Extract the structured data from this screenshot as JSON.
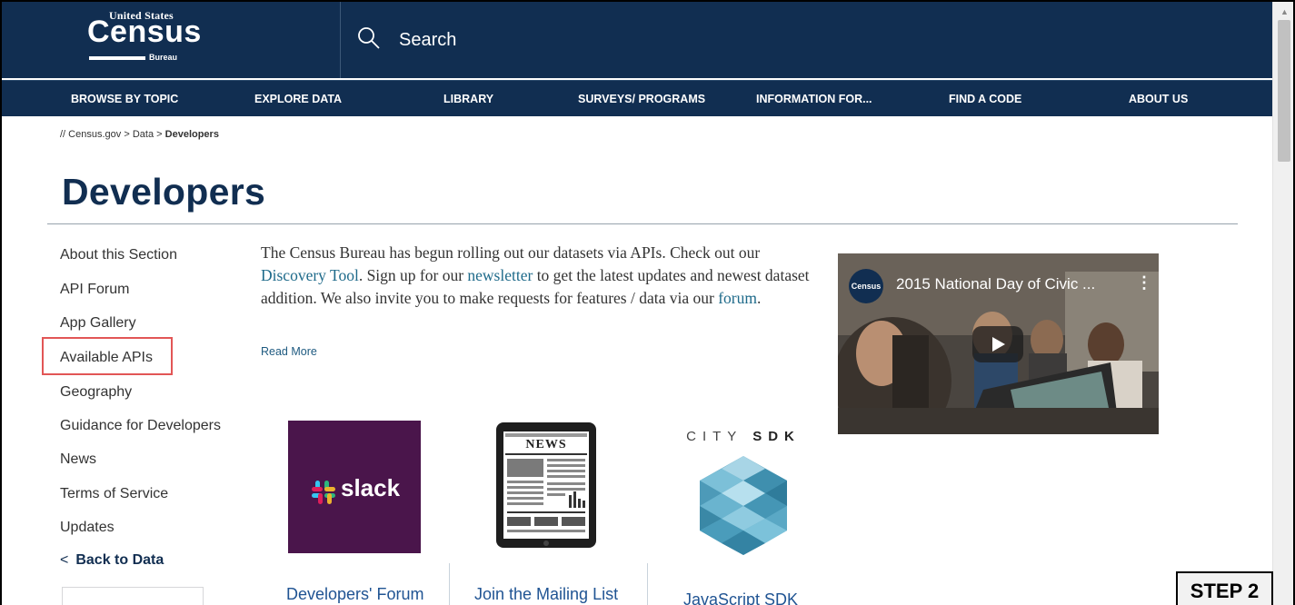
{
  "header": {
    "logo": {
      "line1": "United States",
      "line2": "Census",
      "line3": "Bureau"
    },
    "search_label": "Search"
  },
  "nav": {
    "items": [
      {
        "label": "BROWSE BY TOPIC"
      },
      {
        "label": "EXPLORE DATA"
      },
      {
        "label": "LIBRARY"
      },
      {
        "label": "SURVEYS/ PROGRAMS"
      },
      {
        "label": "INFORMATION FOR..."
      },
      {
        "label": "FIND A CODE"
      },
      {
        "label": "ABOUT US"
      }
    ]
  },
  "breadcrumb": {
    "root": "Census.gov",
    "sep": ">",
    "parent": "Data",
    "current": "Developers"
  },
  "page": {
    "title": "Developers"
  },
  "sidebar": {
    "items": [
      {
        "label": "About this Section"
      },
      {
        "label": "API Forum"
      },
      {
        "label": "App Gallery"
      },
      {
        "label": "Available APIs",
        "highlighted": true
      },
      {
        "label": "Geography"
      },
      {
        "label": "Guidance for Developers"
      },
      {
        "label": "News"
      },
      {
        "label": "Terms of Service"
      },
      {
        "label": "Updates"
      }
    ],
    "back_label": "Back to Data"
  },
  "intro": {
    "t1": "The Census Bureau has begun rolling out our datasets via APIs.  Check out our ",
    "link1": "Discovery Tool",
    "t2": ". Sign up for our ",
    "link2": "newsletter",
    "t3": " to get the latest updates and newest dataset addition. We also invite you to make requests for features / data via our ",
    "link3": "forum",
    "t4": ".",
    "read_more": "Read More"
  },
  "video": {
    "title": "2015 National Day of Civic ...",
    "channel_badge": "Census"
  },
  "tiles": {
    "slack_logo_text": "slack",
    "news_text": "NEWS",
    "city_sdk_label_light": "CITY",
    "city_sdk_label_bold": "SDK",
    "labels": [
      "Developers' Forum",
      "Join the Mailing List",
      "JavaScript SDK"
    ]
  },
  "overlay": {
    "step_label": "STEP 2"
  },
  "colors": {
    "header_bg": "#112e51",
    "link": "#1e6a8a",
    "highlight_box": "#e25656",
    "slack_bg": "#4a154b"
  }
}
